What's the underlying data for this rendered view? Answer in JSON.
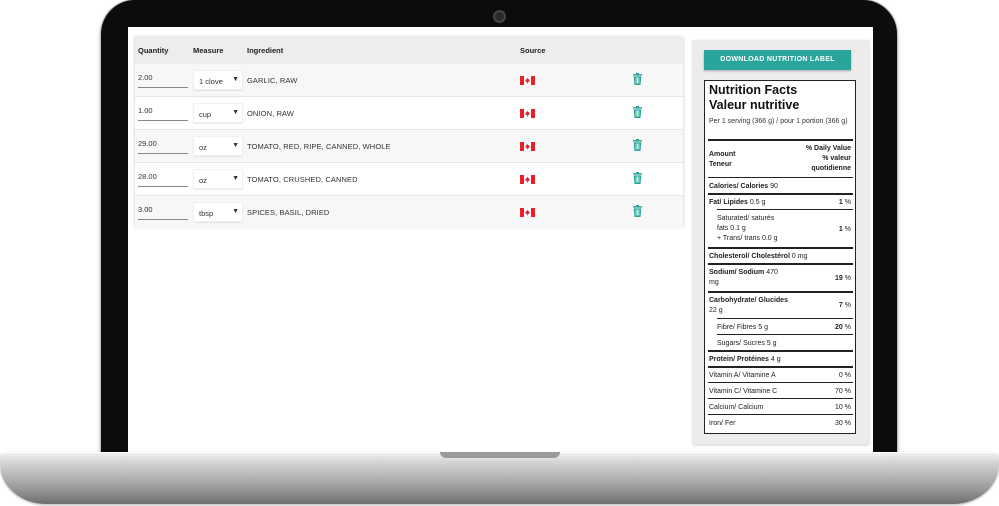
{
  "table": {
    "headers": {
      "quantity": "Quantity",
      "measure": "Measure",
      "ingredient": "Ingredient",
      "source": "Source"
    },
    "rows": [
      {
        "quantity": "2.00",
        "measure": "1 clove",
        "ingredient": "GARLIC, RAW",
        "source": "canada-flag-icon"
      },
      {
        "quantity": "1.00",
        "measure": "cup",
        "ingredient": "ONION, RAW",
        "source": "canada-flag-icon"
      },
      {
        "quantity": "29.00",
        "measure": "oz",
        "ingredient": "TOMATO, RED, RIPE, CANNED, WHOLE",
        "source": "canada-flag-icon"
      },
      {
        "quantity": "28.00",
        "measure": "oz",
        "ingredient": "TOMATO, CRUSHED, CANNED",
        "source": "canada-flag-icon"
      },
      {
        "quantity": "3.00",
        "measure": "tbsp",
        "ingredient": "SPICES, BASIL, DRIED",
        "source": "canada-flag-icon"
      }
    ]
  },
  "nutrition": {
    "download_label": "DOWNLOAD NUTRITION LABEL",
    "title_en": "Nutrition Facts",
    "title_fr": "Valeur nutritive",
    "serving": "Per 1 serving (366 g) / pour 1 portion (366 g)",
    "amount_label": "Amount",
    "teneur_label": "Teneur",
    "dv_label": "% Daily Value",
    "dv_label_fr_1": "% valeur",
    "dv_label_fr_2": "quotidienne",
    "calories_label": "Calories/ Calories",
    "calories_value": "90",
    "fat_label": "Fat/ Lipides",
    "fat_value": "0.5 g",
    "fat_dv": "1",
    "sat_label_1": "Saturated/ saturés",
    "sat_label_2": "fats",
    "sat_value": "0.1 g",
    "trans_label": "+ Trans/ trans",
    "trans_value": "0.0 g",
    "sat_dv": "1",
    "cholesterol_label": "Cholesterol/ Cholestérol",
    "cholesterol_value": "0 mg",
    "sodium_label": "Sodium/ Sodium",
    "sodium_value_1": "470",
    "sodium_value_2": "mg",
    "sodium_dv": "19",
    "carb_label": "Carbohydrate/ Glucides",
    "carb_value": "22 g",
    "carb_dv": "7",
    "fibre_label": "Fibre/ Fibres",
    "fibre_value": "5 g",
    "fibre_dv": "20",
    "sugars_label": "Sugars/ Sucres",
    "sugars_value": "5 g",
    "protein_label": "Protein/ Protéines",
    "protein_value": "4 g",
    "vit_a_label": "Vitamin A/ Vitamine A",
    "vit_a_dv": "0",
    "vit_c_label": "Vitamin C/ Vitamine C",
    "vit_c_dv": "70",
    "calcium_label": "Calcium/ Calcium",
    "calcium_dv": "10",
    "iron_label": "Iron/ Fer",
    "iron_dv": "30",
    "percent_sign": "%"
  },
  "colors": {
    "accent": "#2aa59b",
    "trash": "#2aa59b",
    "flag_red": "#e8202a"
  }
}
